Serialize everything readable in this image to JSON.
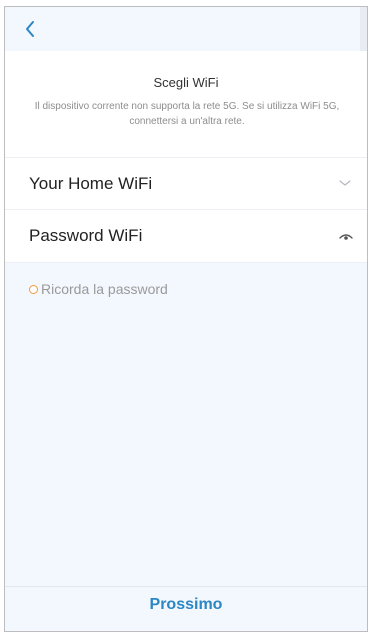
{
  "header": {
    "back_icon": "chevron-left-icon"
  },
  "content": {
    "title": "Scegli WiFi",
    "description": "Il dispositivo corrente non supporta la rete 5G. Se si utilizza WiFi 5G, connettersi a un'altra rete."
  },
  "form": {
    "wifi_name": "Your Home WiFi",
    "wifi_dropdown_icon": "chevron-down-icon",
    "password_label": "Password WiFi",
    "password_toggle_icon": "eye-icon",
    "remember_label": "Ricorda la password"
  },
  "footer": {
    "next_label": "Prossimo"
  },
  "colors": {
    "accent": "#2b86c4",
    "background": "#f3f7fe",
    "remember_dot": "#f39a3c"
  }
}
